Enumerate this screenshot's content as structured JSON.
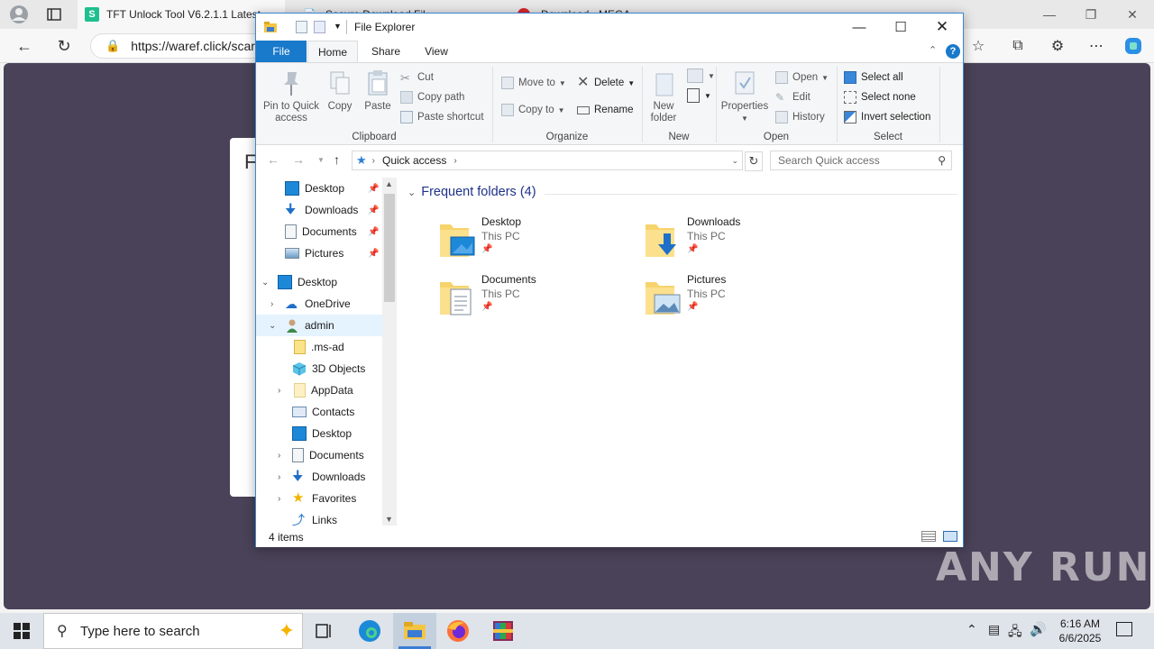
{
  "browser": {
    "tabs": [
      {
        "title": "TFT Unlock Tool V6.2.1.1 Latest"
      },
      {
        "title": "Secure Download Fil"
      },
      {
        "title": "Download - MEGA"
      }
    ],
    "url": "https://waref.click/scar"
  },
  "web_page": {
    "card_letter": "F"
  },
  "explorer": {
    "title": "File Explorer",
    "tabs": {
      "file": "File",
      "home": "Home",
      "share": "Share",
      "view": "View"
    },
    "ribbon": {
      "clipboard": {
        "label": "Clipboard",
        "pin": "Pin to Quick access",
        "copy": "Copy",
        "paste": "Paste",
        "cut": "Cut",
        "copy_path": "Copy path",
        "paste_shortcut": "Paste shortcut"
      },
      "organize": {
        "label": "Organize",
        "move_to": "Move to",
        "copy_to": "Copy to",
        "delete": "Delete",
        "rename": "Rename"
      },
      "new": {
        "label": "New",
        "new_folder": "New folder"
      },
      "open": {
        "label": "Open",
        "properties": "Properties",
        "open": "Open",
        "edit": "Edit",
        "history": "History"
      },
      "select": {
        "label": "Select",
        "select_all": "Select all",
        "select_none": "Select none",
        "invert": "Invert selection"
      }
    },
    "address": {
      "location": "Quick access"
    },
    "search": {
      "placeholder": "Search Quick access"
    },
    "nav_pane": {
      "quick_access": [
        {
          "label": "Desktop"
        },
        {
          "label": "Downloads"
        },
        {
          "label": "Documents"
        },
        {
          "label": "Pictures"
        }
      ],
      "tree": [
        {
          "label": "Desktop"
        },
        {
          "label": "OneDrive"
        },
        {
          "label": "admin"
        },
        {
          "label": ".ms-ad"
        },
        {
          "label": "3D Objects"
        },
        {
          "label": "AppData"
        },
        {
          "label": "Contacts"
        },
        {
          "label": "Desktop"
        },
        {
          "label": "Documents"
        },
        {
          "label": "Downloads"
        },
        {
          "label": "Favorites"
        },
        {
          "label": "Links"
        }
      ]
    },
    "content": {
      "group_title": "Frequent folders (4)",
      "folders": [
        {
          "name": "Desktop",
          "location": "This PC"
        },
        {
          "name": "Downloads",
          "location": "This PC"
        },
        {
          "name": "Documents",
          "location": "This PC"
        },
        {
          "name": "Pictures",
          "location": "This PC"
        }
      ]
    },
    "status": {
      "count": "4 items"
    }
  },
  "taskbar": {
    "search_placeholder": "Type here to search",
    "time": "6:16 AM",
    "date": "6/6/2025"
  },
  "watermark": "ANY RUN"
}
